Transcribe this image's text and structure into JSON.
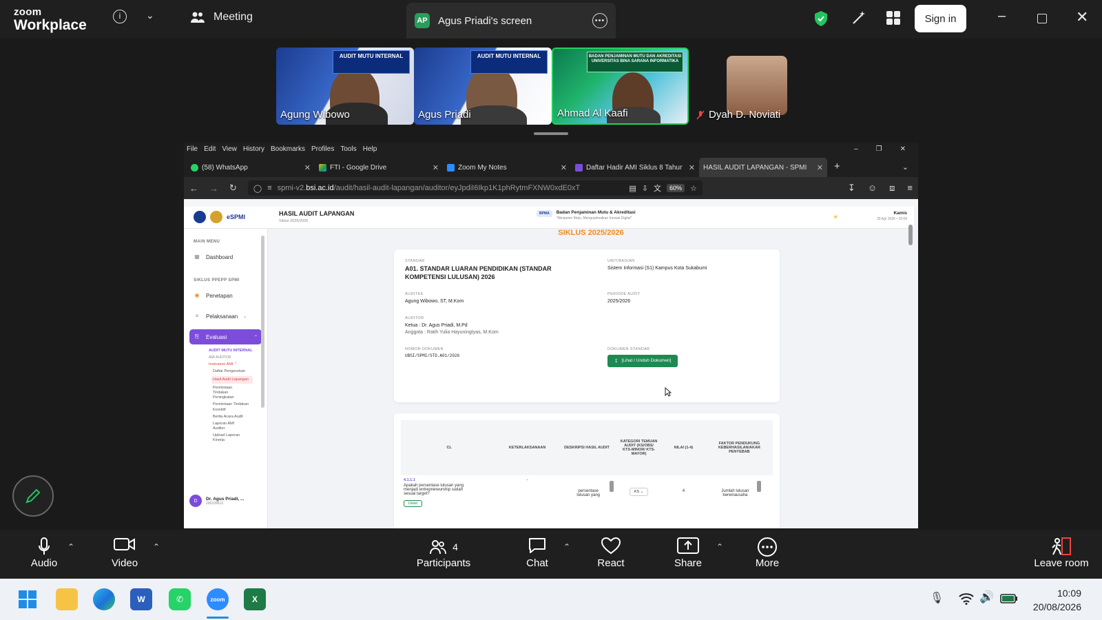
{
  "zoom": {
    "brand_top": "zoom",
    "brand_bottom": "Workplace",
    "meeting_label": "Meeting",
    "screen_share_avatar": "AP",
    "screen_share_label": "Agus Priadi's screen",
    "sign_in_label": "Sign in"
  },
  "participants": [
    {
      "name": "Agung Wibowo",
      "banner": "AUDIT MUTU INTERNAL"
    },
    {
      "name": "Agus Priadi",
      "banner": "AUDIT MUTU INTERNAL"
    },
    {
      "name": "Ahmad Al Kaafi",
      "banner": "BADAN PENJAMINAN MUTU DAN AKREDITASI UNIVERSITAS BINA SARANA INFORMATIKA"
    },
    {
      "name": "Dyah D. Noviati"
    }
  ],
  "browser": {
    "menu": [
      "File",
      "Edit",
      "View",
      "History",
      "Bookmarks",
      "Profiles",
      "Tools",
      "Help"
    ],
    "tabs": [
      {
        "label": "(58) WhatsApp",
        "color": "#25d366"
      },
      {
        "label": "FTI - Google Drive",
        "color": "#f4b400"
      },
      {
        "label": "Zoom My Notes",
        "color": "#2d8cff"
      },
      {
        "label": "Daftar Hadir AMI Siklus 8 Tahun",
        "color": "#7c4ddb"
      },
      {
        "label": "HASIL AUDIT LAPANGAN - SPMI",
        "color": ""
      }
    ],
    "url_prefix": "spmi-v2.",
    "url_host": "bsi.ac.id",
    "url_path": "/audit/hasil-audit-lapangan/auditor/eyJpdiI6Ikp1K1phRytmFXNW0xdE0xT",
    "zoom_level": "60%"
  },
  "app": {
    "page_title": "HASIL AUDIT LAPANGAN",
    "page_subtitle": "Siklus 2025/2026",
    "org_name": "Badan Penjaminan Mutu & Akreditasi",
    "org_tagline": "\"Menjamin Mutu, Mengoptimalkan Inovasi Digital\"",
    "org_badge": "BPMA",
    "day_label": "Kamis",
    "date_label": "20 Agr 2026 • 10:09",
    "logo_text": "eSPMI",
    "cycle_heading": "SIKLUS 2025/2026",
    "sidebar": {
      "section_main": "MAIN MENU",
      "dashboard": "Dashboard",
      "section_cycle": "SIKLUS PPEPP SPMI",
      "penetapan": "Penetapan",
      "pelaksanaan": "Pelaksanaan",
      "evaluasi": "Evaluasi",
      "sub_ami": "AUDIT MUTU INTERNAL",
      "sub_auditor": "AMI AUDITOR",
      "instrumen": "Instrumen AMI",
      "daftar": "Daftar Pengecekan",
      "hasil": "Hasil Audit Lapangan",
      "ptp": "Permintaan Tindakan Peningkatan",
      "ptk": "Permintaan Tindakan Korektif",
      "berita": "Berita Acara Audit",
      "laporan": "Laporan AMI Auditor",
      "upload": "Upload Laporan Kinerja",
      "user_initial": "D",
      "user_name": "Dr. Agus Priadi, ...",
      "user_id": "200109613"
    },
    "info": {
      "standar_label": "STANDAR",
      "standar_value": "A01. STANDAR LUARAN PENDIDIKAN (STANDAR KOMPETENSI LULUSAN) 2026",
      "unit_label": "UNIT/BAGIAN",
      "unit_value": "Sistem Informasi (S1) Kampus Kota Sukabumi",
      "auditee_label": "AUDITEE",
      "auditee_value": "Agung Wibowo, ST, M.Kom",
      "periode_label": "PERIODE AUDIT",
      "periode_value": "2025/2026",
      "auditor_label": "AUDITOR",
      "auditor_ketua": "Ketua : Dr. Agus Priadi, M.Pd",
      "auditor_anggota": "Anggota : Ratih Yulia Hayuningtyas, M.Kom",
      "nomor_label": "NOMOR DOKUMEN",
      "nomor_value": "UBSI/SPMI/STD.A01/2026",
      "dokumen_label": "DOKUMEN STANDAR",
      "dokumen_button": "[Lihat / Unduh Dokumen]"
    },
    "table": {
      "headers": [
        "CL",
        "KETERLAKSANAAN",
        "DESKRIPSI HASIL AUDIT",
        "KATEGORI TEMUAN AUDIT (KS/OBS/ KTS-MINOR/ KTS-MAYOR)",
        "NILAI (1-4)",
        "FAKTOR PENDUKUNG KEBERHASILAN/AKAR PENYEBAB"
      ],
      "row_code": "4.1.1.1",
      "row_question": "Apakah persentase lulusan yang menjadi entrepreneurship sudah sesuai target?",
      "row_detail": "Detail",
      "row_ket": "-",
      "row_desc": "persentase lulusan yang",
      "row_kategori": "KS",
      "row_nilai": "4",
      "row_faktor": "Jumlah lulusan berwirausaha"
    }
  },
  "controls": {
    "audio": "Audio",
    "video": "Video",
    "participants": "Participants",
    "participants_count": "4",
    "chat": "Chat",
    "react": "React",
    "share": "Share",
    "more": "More",
    "leave": "Leave room"
  },
  "taskbar": {
    "time": "10:09",
    "date": "20/08/2026"
  }
}
